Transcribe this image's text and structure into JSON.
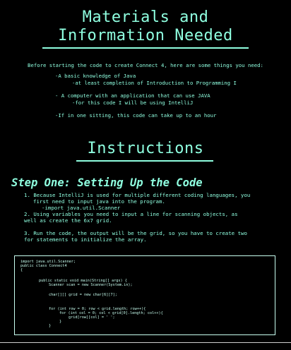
{
  "materials": {
    "title_line1": "Materials and",
    "title_line2": "Information Needed",
    "intro": "Before starting the code to create Connect 4, here are some things you need:",
    "items": [
      "-A basic knowledge of Java",
      "-at least completion of Introduction to Programming I",
      "- A computer with an application that can use JAVA",
      "-for this code I will be using IntelliJ",
      "-If in one sitting, this code can take up to an hour"
    ]
  },
  "instructions": {
    "title": "Instructions",
    "step_title": "Step One: Setting Up the Code",
    "lines": [
      "1. Because IntelliJ is used for multiple different coding languages, you",
      "first need to input java into the program.",
      "-import java.util.Scanner",
      "2. Using variables you need to input a line for scanning objects, as",
      "well as create the 6x7 grid.",
      "3. Run the code, the output will be the grid, so you have to create two",
      "for statements to initialize the array."
    ]
  },
  "code": {
    "lines": [
      "import java.util.Scanner;",
      "public class Connect4",
      "{",
      "public static void main(String[] args) {",
      "Scanner scan = new Scanner(System.in);",
      "char[][] grid = new char[6][7];",
      "for (int row = 0; row < grid.length; row++){",
      "for (int col = 0; col < grid[0].length; col++){",
      "grid[row][col] = ' ';",
      "}",
      "}"
    ]
  }
}
